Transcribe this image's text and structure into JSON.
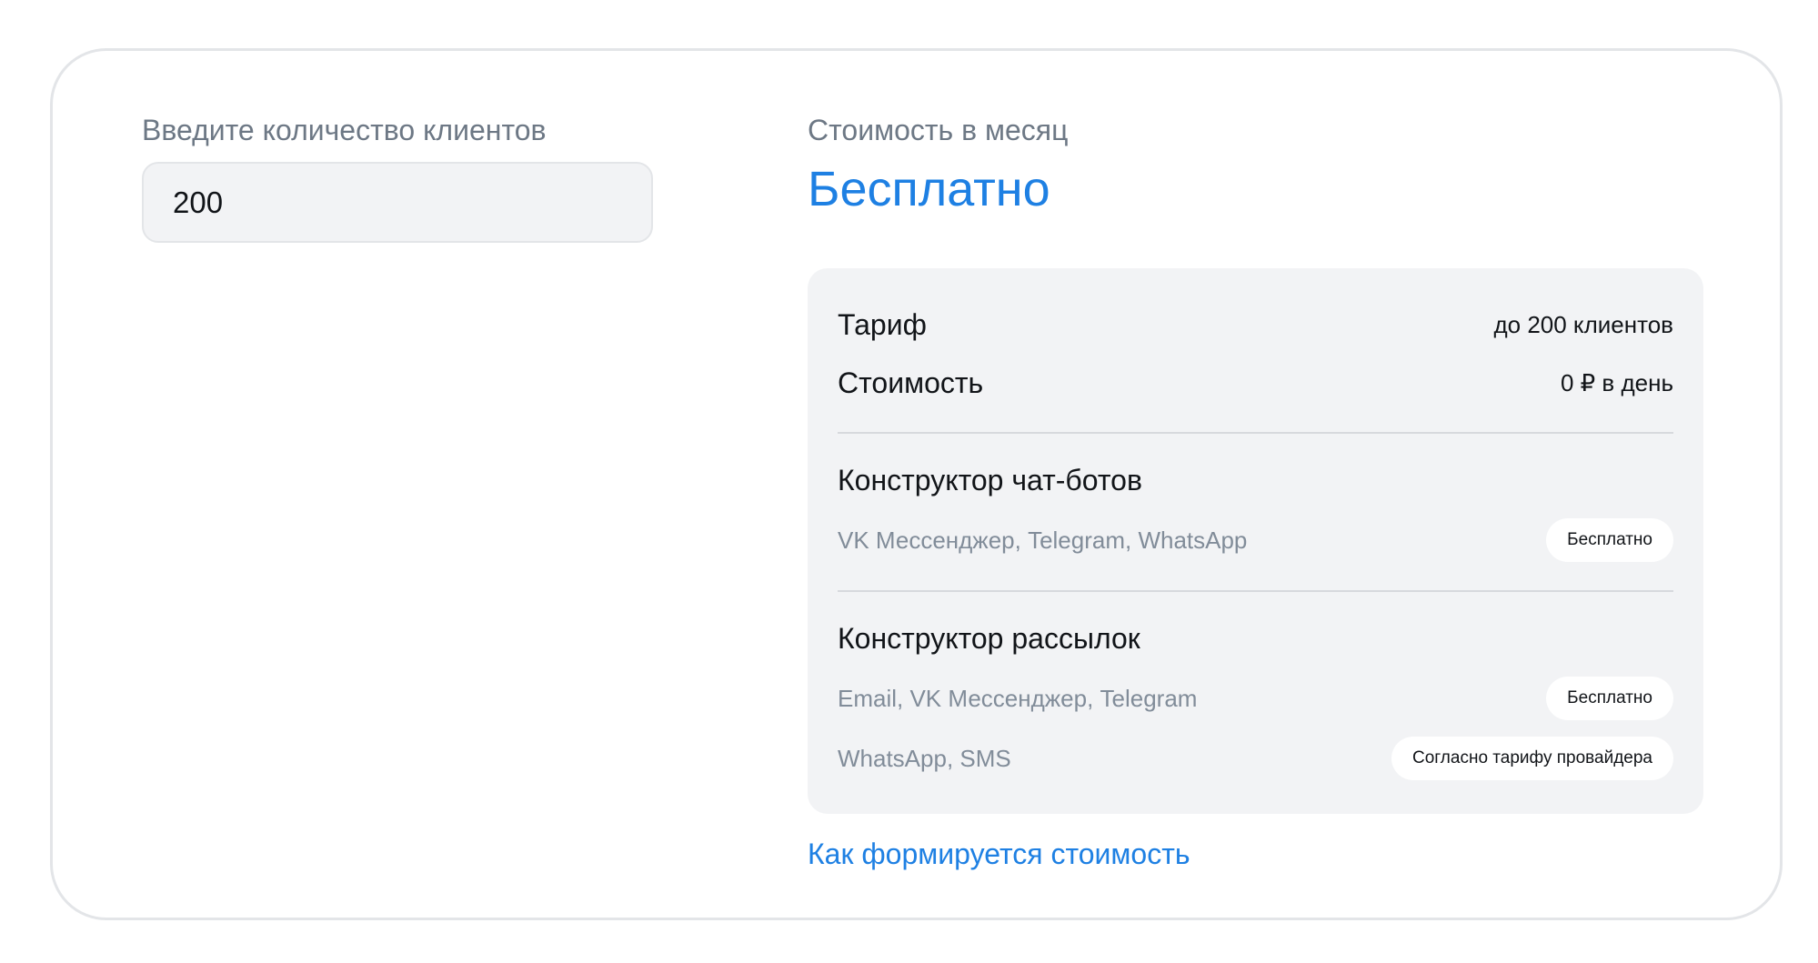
{
  "colors": {
    "accent": "#1e80e3",
    "muted_text": "#6d7885",
    "panel_bg": "#f2f3f5",
    "card_border": "#e3e5e8"
  },
  "clients": {
    "label": "Введите количество клиентов",
    "value": "200"
  },
  "price": {
    "label": "Стоимость в месяц",
    "value": "Бесплатно"
  },
  "details": {
    "tariff_key": "Тариф",
    "tariff_value": "до 200 клиентов",
    "cost_key": "Стоимость",
    "cost_value": "0 ₽ в день",
    "chatbots": {
      "title": "Конструктор чат-ботов",
      "channels": "VK Мессенджер, Telegram, WhatsApp",
      "price": "Бесплатно"
    },
    "mailings": {
      "title": "Конструктор рассылок",
      "channels_free": "Email, VK Мессенджер, Telegram",
      "price_free": "Бесплатно",
      "channels_paid": "WhatsApp, SMS",
      "price_paid": "Согласно тарифу провайдера"
    }
  },
  "how_link": "Как формируется стоимость"
}
